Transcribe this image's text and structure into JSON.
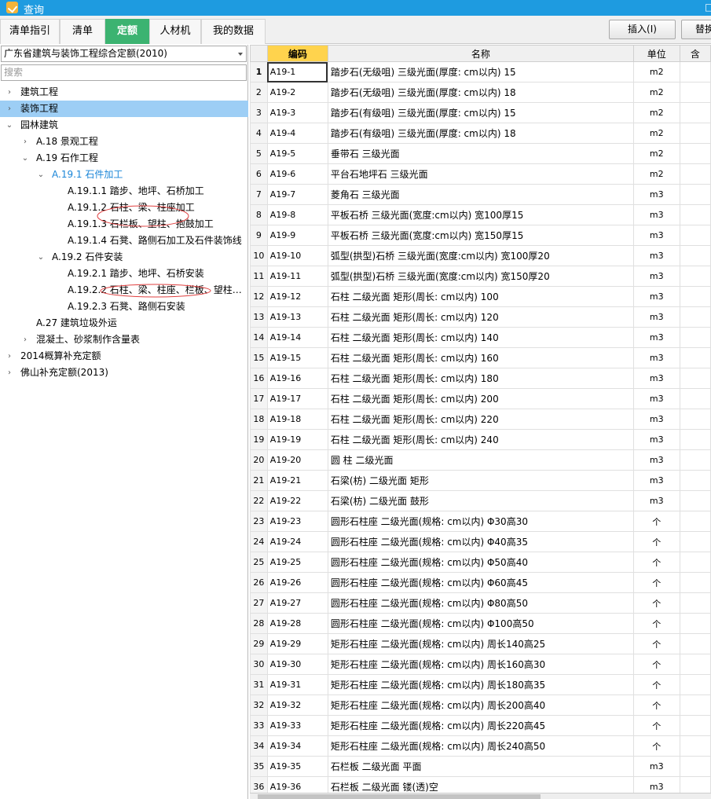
{
  "window": {
    "title": "查询",
    "max_icon": "maximize-icon"
  },
  "tabs": [
    {
      "label": "清单指引",
      "active": false
    },
    {
      "label": "清单",
      "active": false
    },
    {
      "label": "定额",
      "active": true
    },
    {
      "label": "人材机",
      "active": false
    },
    {
      "label": "我的数据",
      "active": false
    }
  ],
  "buttons": {
    "insert": "插入(I)",
    "replace": "替换"
  },
  "library": {
    "selected": "广东省建筑与装饰工程综合定额(2010)"
  },
  "search": {
    "placeholder": "搜索"
  },
  "tree": [
    {
      "label": "建筑工程",
      "level": 0,
      "toggle": ">",
      "selected": false,
      "highlight": false
    },
    {
      "label": "装饰工程",
      "level": 0,
      "toggle": ">",
      "selected": true,
      "highlight": false
    },
    {
      "label": "园林建筑",
      "level": 0,
      "toggle": "v",
      "selected": false,
      "highlight": false
    },
    {
      "label": "A.18 景观工程",
      "level": 1,
      "toggle": ">",
      "selected": false,
      "highlight": false
    },
    {
      "label": "A.19 石作工程",
      "level": 1,
      "toggle": "v",
      "selected": false,
      "highlight": false
    },
    {
      "label": "A.19.1 石件加工",
      "level": 2,
      "toggle": "v",
      "selected": false,
      "highlight": true
    },
    {
      "label": "A.19.1.1 踏步、地坪、石桥加工",
      "level": 3,
      "toggle": "",
      "selected": false,
      "highlight": false
    },
    {
      "label": "A.19.1.2 石柱、梁、柱座加工",
      "level": 3,
      "toggle": "",
      "selected": false,
      "highlight": false
    },
    {
      "label": "A.19.1.3 石栏板、望柱、抱鼓加工",
      "level": 3,
      "toggle": "",
      "selected": false,
      "highlight": false
    },
    {
      "label": "A.19.1.4 石凳、路侧石加工及石件装饰线",
      "level": 3,
      "toggle": "",
      "selected": false,
      "highlight": false
    },
    {
      "label": "A.19.2 石件安装",
      "level": 2,
      "toggle": "v",
      "selected": false,
      "highlight": false
    },
    {
      "label": "A.19.2.1 踏步、地坪、石桥安装",
      "level": 3,
      "toggle": "",
      "selected": false,
      "highlight": false
    },
    {
      "label": "A.19.2.2 石柱、梁、柱座、栏板、望柱…",
      "level": 3,
      "toggle": "",
      "selected": false,
      "highlight": false
    },
    {
      "label": "A.19.2.3 石凳、路侧石安装",
      "level": 3,
      "toggle": "",
      "selected": false,
      "highlight": false
    },
    {
      "label": "A.27 建筑垃圾外运",
      "level": 1,
      "toggle": "",
      "selected": false,
      "highlight": false
    },
    {
      "label": "混凝土、砂浆制作含量表",
      "level": 1,
      "toggle": ">",
      "selected": false,
      "highlight": false
    },
    {
      "label": "2014概算补充定额",
      "level": 0,
      "toggle": ">",
      "selected": false,
      "highlight": false
    },
    {
      "label": "佛山补充定额(2013)",
      "level": 0,
      "toggle": ">",
      "selected": false,
      "highlight": false
    }
  ],
  "grid": {
    "headers": {
      "num": "",
      "code": "编码",
      "name": "名称",
      "unit": "单位",
      "extra": "含"
    },
    "rows": [
      {
        "n": "1",
        "code": "A19-1",
        "name": "踏步石(无级咀) 三级光面(厚度: cm以内) 15",
        "unit": "m2"
      },
      {
        "n": "2",
        "code": "A19-2",
        "name": "踏步石(无级咀) 三级光面(厚度: cm以内) 18",
        "unit": "m2"
      },
      {
        "n": "3",
        "code": "A19-3",
        "name": "踏步石(有级咀) 三级光面(厚度: cm以内) 15",
        "unit": "m2"
      },
      {
        "n": "4",
        "code": "A19-4",
        "name": "踏步石(有级咀) 三级光面(厚度: cm以内) 18",
        "unit": "m2"
      },
      {
        "n": "5",
        "code": "A19-5",
        "name": "垂带石 三级光面",
        "unit": "m2"
      },
      {
        "n": "6",
        "code": "A19-6",
        "name": "平台石地坪石 三级光面",
        "unit": "m2"
      },
      {
        "n": "7",
        "code": "A19-7",
        "name": "菱角石 三级光面",
        "unit": "m3"
      },
      {
        "n": "8",
        "code": "A19-8",
        "name": "平板石桥 三级光面(宽度:cm以内) 宽100厚15",
        "unit": "m3"
      },
      {
        "n": "9",
        "code": "A19-9",
        "name": "平板石桥 三级光面(宽度:cm以内) 宽150厚15",
        "unit": "m3"
      },
      {
        "n": "10",
        "code": "A19-10",
        "name": "弧型(拱型)石桥 三级光面(宽度:cm以内) 宽100厚20",
        "unit": "m3"
      },
      {
        "n": "11",
        "code": "A19-11",
        "name": "弧型(拱型)石桥 三级光面(宽度:cm以内) 宽150厚20",
        "unit": "m3"
      },
      {
        "n": "12",
        "code": "A19-12",
        "name": "石柱 二级光面 矩形(周长: cm以内) 100",
        "unit": "m3"
      },
      {
        "n": "13",
        "code": "A19-13",
        "name": "石柱 二级光面 矩形(周长: cm以内) 120",
        "unit": "m3"
      },
      {
        "n": "14",
        "code": "A19-14",
        "name": "石柱 二级光面 矩形(周长: cm以内) 140",
        "unit": "m3"
      },
      {
        "n": "15",
        "code": "A19-15",
        "name": "石柱 二级光面 矩形(周长: cm以内) 160",
        "unit": "m3"
      },
      {
        "n": "16",
        "code": "A19-16",
        "name": "石柱 二级光面 矩形(周长: cm以内) 180",
        "unit": "m3"
      },
      {
        "n": "17",
        "code": "A19-17",
        "name": "石柱 二级光面 矩形(周长: cm以内) 200",
        "unit": "m3"
      },
      {
        "n": "18",
        "code": "A19-18",
        "name": "石柱 二级光面 矩形(周长: cm以内) 220",
        "unit": "m3"
      },
      {
        "n": "19",
        "code": "A19-19",
        "name": "石柱 二级光面 矩形(周长: cm以内) 240",
        "unit": "m3"
      },
      {
        "n": "20",
        "code": "A19-20",
        "name": "圆 柱 二级光面",
        "unit": "m3"
      },
      {
        "n": "21",
        "code": "A19-21",
        "name": "石梁(枋) 二级光面 矩形",
        "unit": "m3"
      },
      {
        "n": "22",
        "code": "A19-22",
        "name": "石梁(枋) 二级光面 鼓形",
        "unit": "m3"
      },
      {
        "n": "23",
        "code": "A19-23",
        "name": "圆形石柱座 二级光面(规格: cm以内) Φ30高30",
        "unit": "个"
      },
      {
        "n": "24",
        "code": "A19-24",
        "name": "圆形石柱座 二级光面(规格: cm以内) Φ40高35",
        "unit": "个"
      },
      {
        "n": "25",
        "code": "A19-25",
        "name": "圆形石柱座 二级光面(规格: cm以内) Φ50高40",
        "unit": "个"
      },
      {
        "n": "26",
        "code": "A19-26",
        "name": "圆形石柱座 二级光面(规格: cm以内) Φ60高45",
        "unit": "个"
      },
      {
        "n": "27",
        "code": "A19-27",
        "name": "圆形石柱座 二级光面(规格: cm以内) Φ80高50",
        "unit": "个"
      },
      {
        "n": "28",
        "code": "A19-28",
        "name": "圆形石柱座 二级光面(规格: cm以内) Φ100高50",
        "unit": "个"
      },
      {
        "n": "29",
        "code": "A19-29",
        "name": "矩形石柱座 二级光面(规格: cm以内) 周长140高25",
        "unit": "个"
      },
      {
        "n": "30",
        "code": "A19-30",
        "name": "矩形石柱座 二级光面(规格: cm以内) 周长160高30",
        "unit": "个"
      },
      {
        "n": "31",
        "code": "A19-31",
        "name": "矩形石柱座 二级光面(规格: cm以内) 周长180高35",
        "unit": "个"
      },
      {
        "n": "32",
        "code": "A19-32",
        "name": "矩形石柱座 二级光面(规格: cm以内) 周长200高40",
        "unit": "个"
      },
      {
        "n": "33",
        "code": "A19-33",
        "name": "矩形石柱座 二级光面(规格: cm以内) 周长220高45",
        "unit": "个"
      },
      {
        "n": "34",
        "code": "A19-34",
        "name": "矩形石柱座 二级光面(规格: cm以内) 周长240高50",
        "unit": "个"
      },
      {
        "n": "35",
        "code": "A19-35",
        "name": "石栏板 二级光面 平面",
        "unit": "m3"
      },
      {
        "n": "36",
        "code": "A19-36",
        "name": "石栏板 二级光面 镂(透)空",
        "unit": "m3"
      }
    ]
  }
}
